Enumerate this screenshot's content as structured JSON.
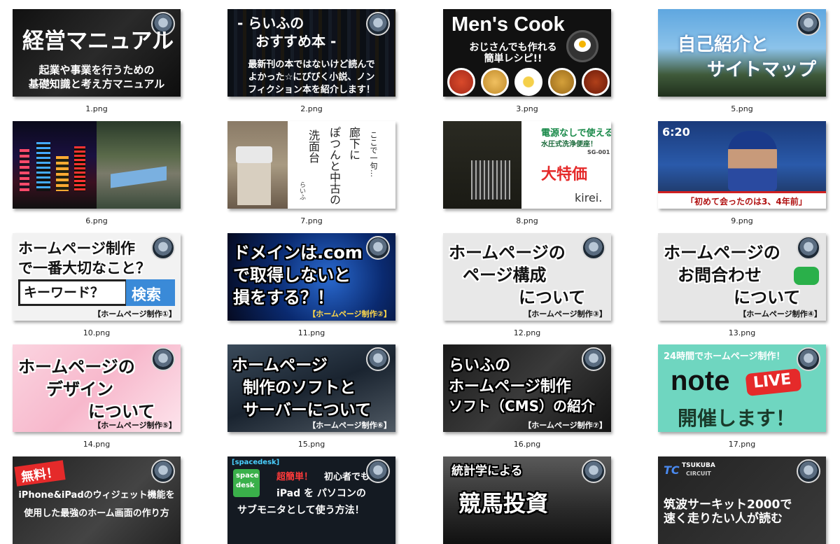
{
  "files": [
    {
      "name": "1.png",
      "title": "経営マニュアル",
      "sub1": "起業や事業を行うための",
      "sub2": "基礎知識と考え方マニュアル"
    },
    {
      "name": "2.png",
      "title1": "- らいふの",
      "title2": "おすすめ本 -",
      "sub1": "最新刊の本ではないけど読んで",
      "sub2": "よかった☆にびびく小説、ノン",
      "sub3": "フィクション本を紹介します！"
    },
    {
      "name": "3.png",
      "title": "Men's Cook",
      "sub1": "おじさんでも作れる",
      "sub2": "簡単レシピ!!"
    },
    {
      "name": "5.png",
      "title1": "自己紹介と",
      "title2": "サイトマップ"
    },
    {
      "name": "6.png"
    },
    {
      "name": "7.png",
      "v1": "ここで一句…",
      "v2": "廊下に",
      "v3": "ぽつんと中古の",
      "v4": "洗面台",
      "v5": "らいふ"
    },
    {
      "name": "8.png",
      "ad1": "電源なしで使える",
      "ad2": "水圧式洗浄便座！",
      "ad3": "SG-001",
      "ad4": "大特価",
      "brand": "kirei."
    },
    {
      "name": "9.png",
      "time": "6:20",
      "caption": "「初めて会ったのは3、4年前」"
    },
    {
      "name": "10.png",
      "title1": "ホームページ制作",
      "title2": "で一番大切なこと？",
      "kw": "キーワード？",
      "search": "検索",
      "tag": "【ホームページ制作①】"
    },
    {
      "name": "11.png",
      "title1": "ドメインは.com",
      "title2": "で取得しないと",
      "title3": "損をする？！",
      "tag": "【ホームページ制作②】"
    },
    {
      "name": "12.png",
      "title1": "ホームページの",
      "title2": "ページ構成",
      "title3": "について",
      "tag": "【ホームページ制作③】"
    },
    {
      "name": "13.png",
      "title1": "ホームページの",
      "title2": "お問合わせ",
      "title3": "について",
      "tag": "【ホームページ制作④】"
    },
    {
      "name": "14.png",
      "title1": "ホームページの",
      "title2": "デザイン",
      "title3": "について",
      "tag": "【ホームページ制作⑤】"
    },
    {
      "name": "15.png",
      "title1": "ホームページ",
      "title2": "制作のソフトと",
      "title3": "サーバーについて",
      "tag": "【ホームページ制作⑥】"
    },
    {
      "name": "16.png",
      "title1": "らいふの",
      "title2": "ホームページ制作",
      "title3": "ソフト（CMS）の紹介",
      "tag": "【ホームページ制作⑦】"
    },
    {
      "name": "17.png",
      "top": "24時間でホームページ制作！",
      "note": "note",
      "live": "LIVE",
      "bottom": "開催します！"
    },
    {
      "name": "",
      "badge": "無料！",
      "sub1": "iPhone&iPadのウィジェット機能を",
      "sub2": "使用した最強のホーム画面の作り方"
    },
    {
      "name": "",
      "label": "[spacedesk]",
      "logo1": "space",
      "logo2": "desk",
      "l1a": "超簡単！",
      "l1b": "初心者でも",
      "l2": "iPad を パソコンの",
      "l3": "サブモニタとして使う方法！"
    },
    {
      "name": "",
      "title1": "統計学による",
      "title2": "競馬投資"
    },
    {
      "name": "",
      "logo1": "TSUKUBA",
      "logo2": "CIRCUIT",
      "title1": "筑波サーキット2000で",
      "title2": "速く走りたい人が読む"
    }
  ]
}
